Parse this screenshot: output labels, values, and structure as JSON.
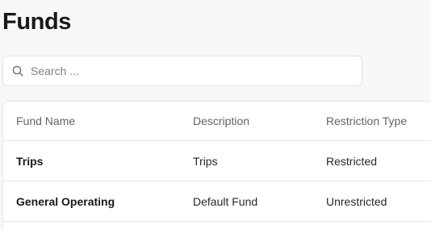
{
  "page": {
    "title": "Funds"
  },
  "search": {
    "placeholder": "Search ...",
    "value": ""
  },
  "table": {
    "columns": [
      "Fund Name",
      "Description",
      "Restriction Type"
    ],
    "rows": [
      {
        "name": "Trips",
        "description": "Trips",
        "restriction": "Restricted"
      },
      {
        "name": "General Operating",
        "description": "Default Fund",
        "restriction": "Unrestricted"
      }
    ]
  },
  "icons": {
    "search": "search-icon"
  },
  "colors": {
    "background": "#f7f8f9",
    "card": "#ffffff",
    "border": "#e3e5e8",
    "header_text": "#5f646b"
  }
}
